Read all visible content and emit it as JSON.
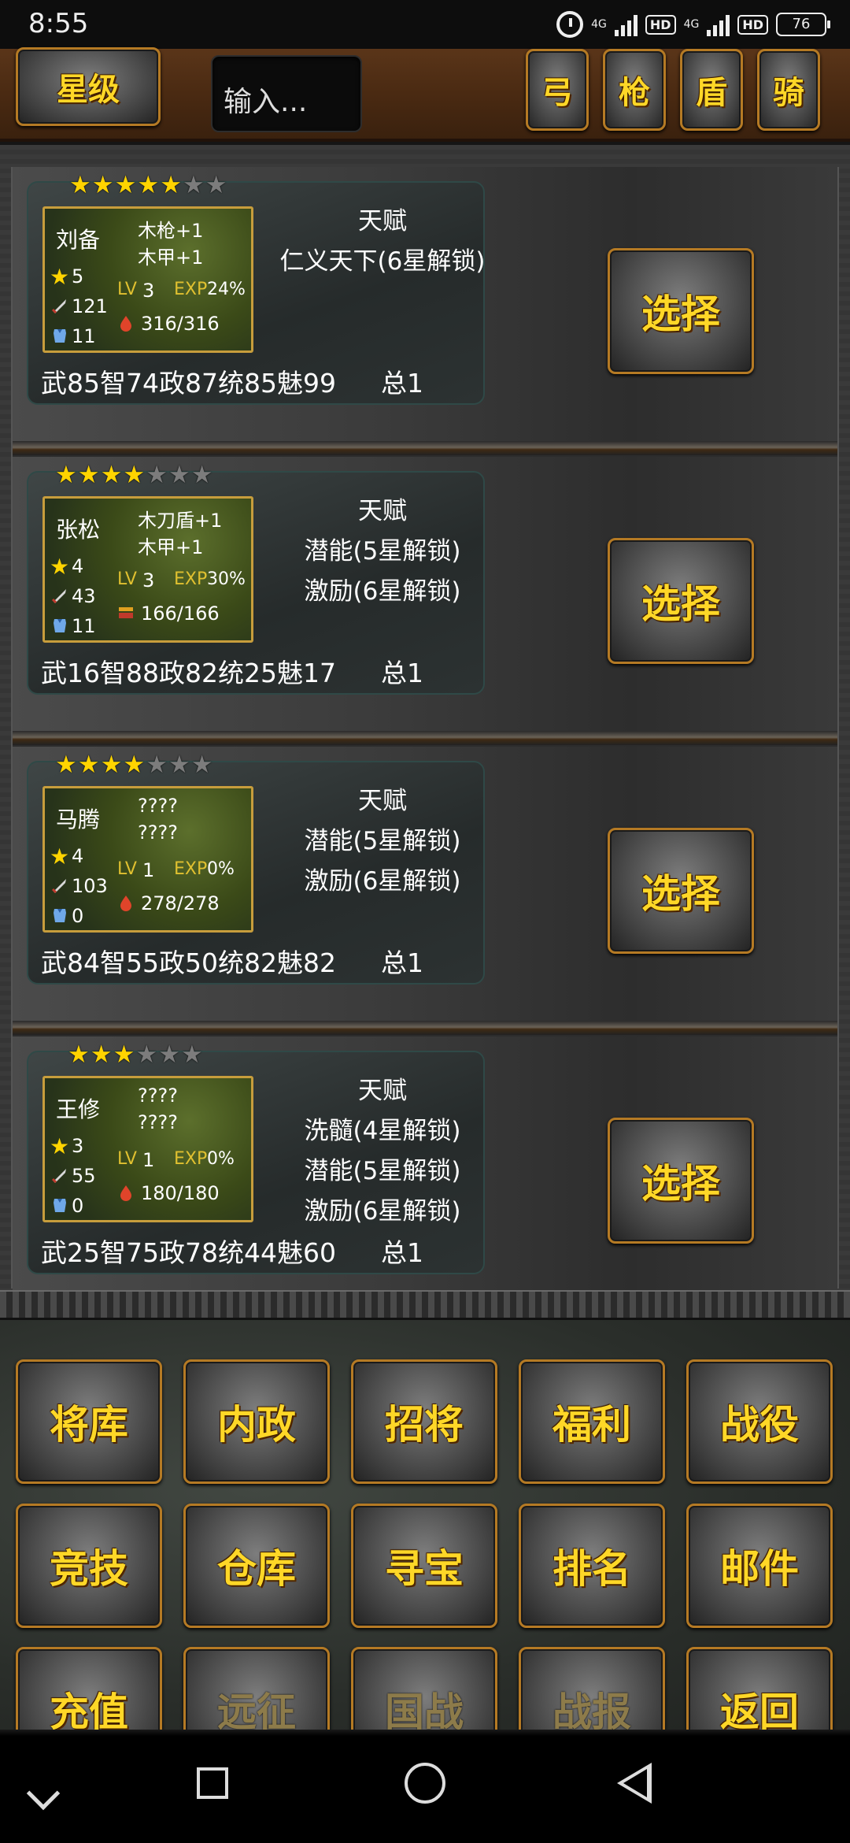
{
  "status_bar": {
    "time": "8:55",
    "network1": "4G",
    "network2": "4G",
    "hd1": "HD",
    "hd2": "HD",
    "battery": "76"
  },
  "toolbar": {
    "star_label": "星级",
    "search_placeholder": "输入...",
    "filters": [
      "弓",
      "枪",
      "盾",
      "骑"
    ]
  },
  "heroes": [
    {
      "stars": 5,
      "max_stars": 7,
      "name": "刘备",
      "equip1": "木枪+1",
      "equip2": "木甲+1",
      "star_level": "5",
      "attack": "121",
      "defense": "11",
      "lv_label": "LV",
      "level": "3",
      "exp_label": "EXP",
      "exp": "24%",
      "hp": "316/316",
      "stats": "武85智74政87统85魅99",
      "total": "总1",
      "talent_title": "天赋",
      "talents": [
        "仁义天下(6星解锁)"
      ],
      "select_label": "选择"
    },
    {
      "stars": 4,
      "max_stars": 7,
      "name": "张松",
      "equip1": "木刀盾+1",
      "equip2": "木甲+1",
      "star_level": "4",
      "attack": "43",
      "defense": "11",
      "lv_label": "LV",
      "level": "3",
      "exp_label": "EXP",
      "exp": "30%",
      "hp": "166/166",
      "stats": "武16智88政82统25魅17",
      "total": "总1",
      "talent_title": "天赋",
      "talents": [
        "潜能(5星解锁)",
        "激励(6星解锁)"
      ],
      "select_label": "选择"
    },
    {
      "stars": 4,
      "max_stars": 7,
      "name": "马腾",
      "equip1": "????",
      "equip2": "????",
      "star_level": "4",
      "attack": "103",
      "defense": "0",
      "lv_label": "LV",
      "level": "1",
      "exp_label": "EXP",
      "exp": "0%",
      "hp": "278/278",
      "stats": "武84智55政50统82魅82",
      "total": "总1",
      "talent_title": "天赋",
      "talents": [
        "潜能(5星解锁)",
        "激励(6星解锁)"
      ],
      "select_label": "选择"
    },
    {
      "stars": 3,
      "max_stars": 6,
      "name": "王修",
      "equip1": "????",
      "equip2": "????",
      "star_level": "3",
      "attack": "55",
      "defense": "0",
      "lv_label": "LV",
      "level": "1",
      "exp_label": "EXP",
      "exp": "0%",
      "hp": "180/180",
      "stats": "武25智75政78统44魅60",
      "total": "总1",
      "talent_title": "天赋",
      "talents": [
        "洗髓(4星解锁)",
        "潜能(5星解锁)",
        "激励(6星解锁)"
      ],
      "select_label": "选择"
    }
  ],
  "menu": [
    {
      "label": "将库",
      "enabled": true
    },
    {
      "label": "内政",
      "enabled": true
    },
    {
      "label": "招将",
      "enabled": true
    },
    {
      "label": "福利",
      "enabled": true
    },
    {
      "label": "战役",
      "enabled": true
    },
    {
      "label": "竞技",
      "enabled": true
    },
    {
      "label": "仓库",
      "enabled": true
    },
    {
      "label": "寻宝",
      "enabled": true
    },
    {
      "label": "排名",
      "enabled": true
    },
    {
      "label": "邮件",
      "enabled": true
    },
    {
      "label": "充值",
      "enabled": true
    },
    {
      "label": "远征",
      "enabled": false
    },
    {
      "label": "国战",
      "enabled": false
    },
    {
      "label": "战报",
      "enabled": false
    },
    {
      "label": "返回",
      "enabled": true
    }
  ],
  "colors": {
    "gold_text": "#ffd727",
    "button_border": "#b57a24",
    "toolbar_bg": "#4a2a12",
    "star_on": "#ffd400",
    "star_off": "#7c7c7c"
  }
}
